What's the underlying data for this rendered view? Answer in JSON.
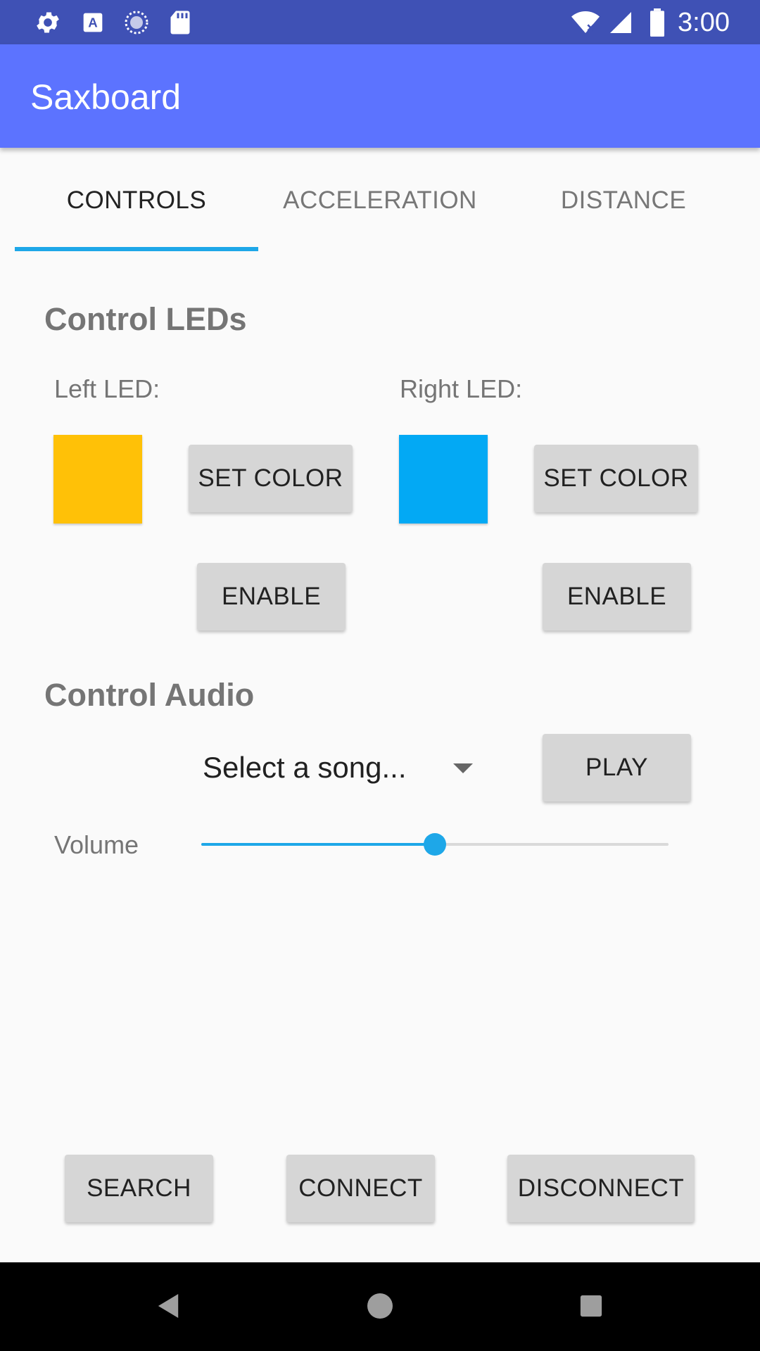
{
  "status_bar": {
    "time": "3:00",
    "left_icons": [
      "settings-icon",
      "a-notification-icon",
      "sync-icon",
      "sd-card-icon"
    ],
    "right_icons": [
      "wifi-icon",
      "signal-icon",
      "battery-icon"
    ]
  },
  "app_bar": {
    "title": "Saxboard"
  },
  "tabs": [
    {
      "label": "CONTROLS",
      "active": true
    },
    {
      "label": "ACCELERATION",
      "active": false
    },
    {
      "label": "DISTANCE",
      "active": false
    }
  ],
  "leds": {
    "title": "Control LEDs",
    "left": {
      "label": "Left LED:",
      "color": "#ffc107",
      "set_color_label": "SET COLOR",
      "enable_label": "ENABLE"
    },
    "right": {
      "label": "Right LED:",
      "color": "#03a9f4",
      "set_color_label": "SET COLOR",
      "enable_label": "ENABLE"
    }
  },
  "audio": {
    "title": "Control Audio",
    "song_select": {
      "value": "Select a song..."
    },
    "play_label": "PLAY",
    "volume_label": "Volume",
    "volume_fraction": 0.5
  },
  "bottom_buttons": {
    "search": "SEARCH",
    "connect": "CONNECT",
    "disconnect": "DISCONNECT"
  },
  "colors": {
    "status_bar": "#3f51b5",
    "app_bar": "#5c73ff",
    "accent": "#1ea7e8"
  }
}
